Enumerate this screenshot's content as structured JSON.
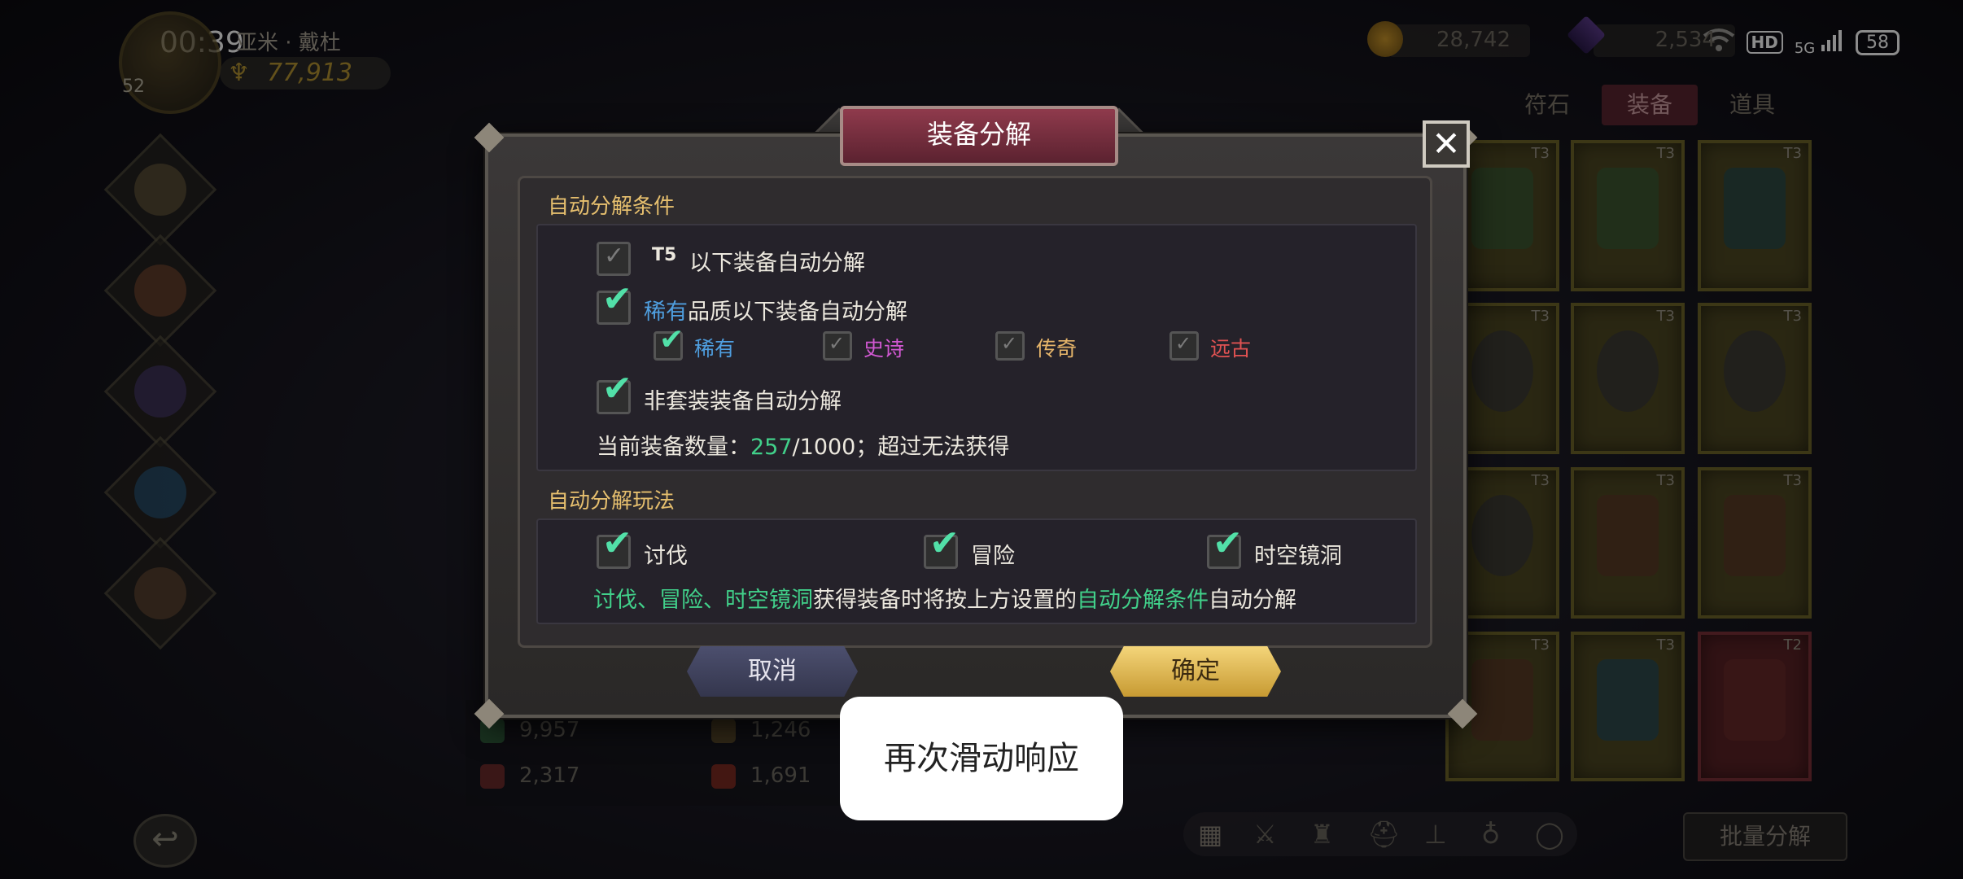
{
  "status_bar": {
    "time": "00:39",
    "hd": "HD",
    "net": "5G",
    "battery": "58"
  },
  "player": {
    "name": "亚米 · 戴杜",
    "level": "52",
    "power": "77,913"
  },
  "currency": {
    "gold": "28,742",
    "gems": "2,534"
  },
  "inventory": {
    "tabs": [
      "符石",
      "装备",
      "道具"
    ],
    "active_tab": "装备",
    "slots": [
      {
        "tier": "T3"
      },
      {
        "tier": "T3"
      },
      {
        "tier": "T3"
      },
      {
        "tier": "T3"
      },
      {
        "tier": "T3"
      },
      {
        "tier": "T3"
      },
      {
        "tier": "T3"
      },
      {
        "tier": "T3"
      },
      {
        "tier": "T3"
      },
      {
        "tier": "T3"
      },
      {
        "tier": "T3"
      },
      {
        "tier": "T2"
      }
    ],
    "batch_label": "批量分解"
  },
  "stats": {
    "s1": "9,957",
    "s2": "1,246",
    "s3": "2,317",
    "s4": "1,691"
  },
  "dialog": {
    "title": "装备分解",
    "section1_title": "自动分解条件",
    "tier_prefix": "T5",
    "tier_rule": "以下装备自动分解",
    "quality_word": "稀有",
    "quality_rule": "品质以下装备自动分解",
    "q_rare": "稀有",
    "q_epic": "史诗",
    "q_legend": "传奇",
    "q_ancient": "远古",
    "nonset_rule": "非套装装备自动分解",
    "count_prefix": "当前装备数量：",
    "count_current": "257",
    "count_suffix": "/1000；超过无法获得",
    "section2_title": "自动分解玩法",
    "mode_hunt": "讨伐",
    "mode_adventure": "冒险",
    "mode_rift": "时空镜洞",
    "note_modes": "讨伐、冒险、时空镜洞",
    "note_mid": "获得装备时将按上方设置的",
    "note_cond": "自动分解条件",
    "note_end": "自动分解",
    "cancel": "取消",
    "confirm": "确定"
  },
  "toast": "再次滑动响应",
  "colors": {
    "check": "#52e0a8",
    "title_bar": "#8f3a4c",
    "confirm": "#f4d57a",
    "cancel": "#4c4f6e"
  }
}
